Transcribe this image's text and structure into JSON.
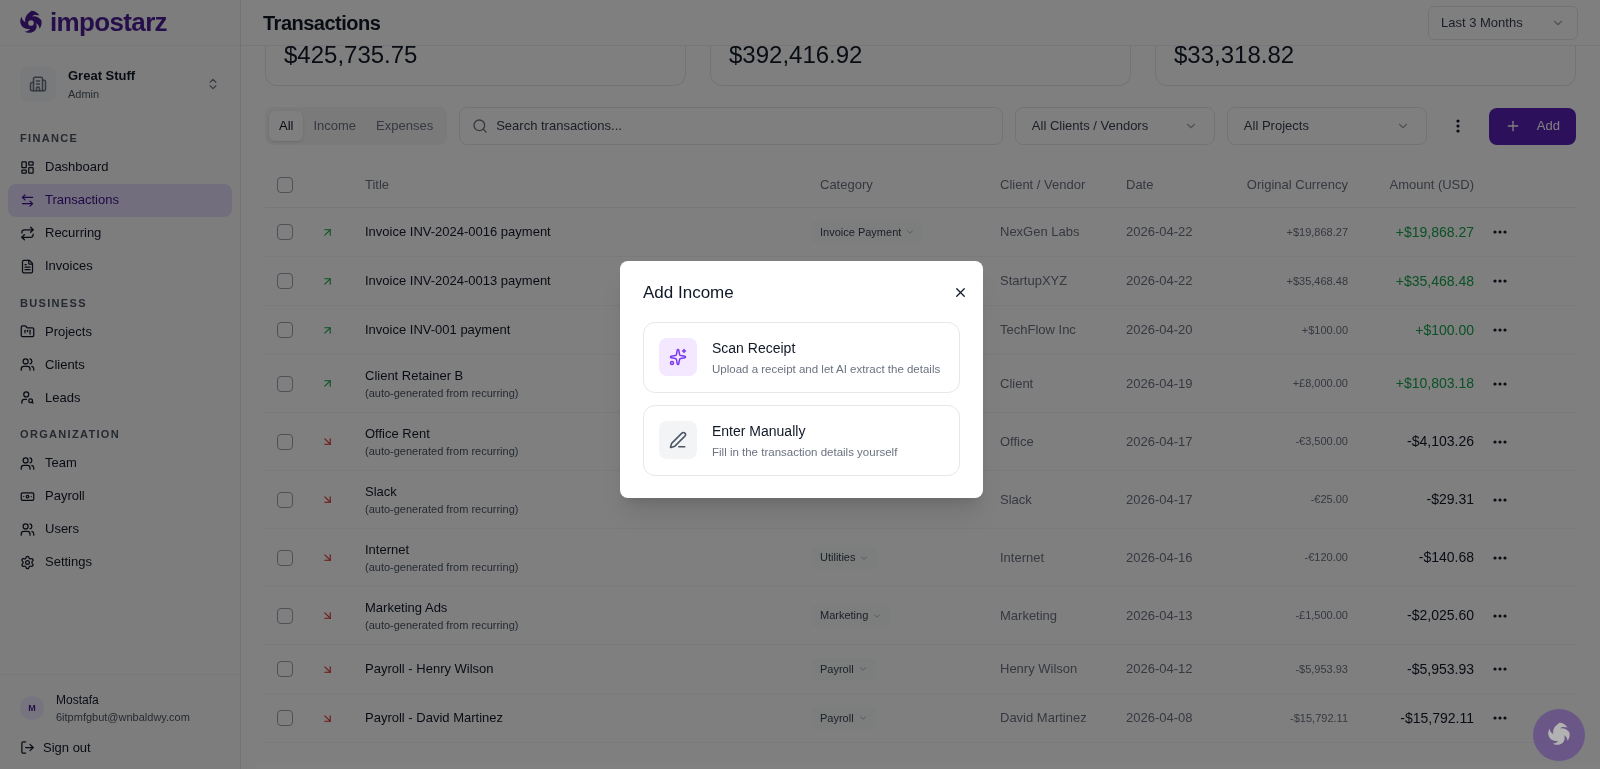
{
  "brand": {
    "name": "impostarz"
  },
  "workspace": {
    "name": "Great Stuff",
    "role": "Admin"
  },
  "sidebar": {
    "sections": [
      {
        "title": "FINANCE",
        "items": [
          {
            "label": "Dashboard",
            "selected": false
          },
          {
            "label": "Transactions",
            "selected": true
          },
          {
            "label": "Recurring",
            "selected": false
          },
          {
            "label": "Invoices",
            "selected": false
          }
        ]
      },
      {
        "title": "BUSINESS",
        "items": [
          {
            "label": "Projects",
            "selected": false
          },
          {
            "label": "Clients",
            "selected": false
          },
          {
            "label": "Leads",
            "selected": false
          }
        ]
      },
      {
        "title": "ORGANIZATION",
        "items": [
          {
            "label": "Team",
            "selected": false
          },
          {
            "label": "Payroll",
            "selected": false
          },
          {
            "label": "Users",
            "selected": false
          },
          {
            "label": "Settings",
            "selected": false
          }
        ]
      }
    ]
  },
  "user": {
    "initial": "M",
    "name": "Mostafa",
    "email": "6itpmfgbut@wnbaldwy.com",
    "sign_out": "Sign out"
  },
  "header": {
    "title": "Transactions",
    "period": "Last 3 Months"
  },
  "stats": [
    "$425,735.75",
    "$392,416.92",
    "$33,318.82"
  ],
  "tabs": [
    {
      "label": "All",
      "selected": true
    },
    {
      "label": "Income",
      "selected": false
    },
    {
      "label": "Expenses",
      "selected": false
    }
  ],
  "search": {
    "placeholder": "Search transactions..."
  },
  "filters": [
    "All Clients / Vendors",
    "All Projects"
  ],
  "add_button": "Add",
  "table": {
    "all_checked": false,
    "columns": [
      "Title",
      "Category",
      "Client / Vendor",
      "Date",
      "Original Currency",
      "Amount (USD)"
    ],
    "rows": [
      {
        "kind": "income",
        "checked": false,
        "title": "Invoice INV-2024-0016 payment",
        "category": "Invoice Payment",
        "client": "NexGen Labs",
        "date": "2026-04-22",
        "original": "+$19,868.27",
        "amount": "+$19,868.27"
      },
      {
        "kind": "income",
        "checked": false,
        "title": "Invoice INV-2024-0013 payment",
        "client": "StartupXYZ",
        "date": "2026-04-22",
        "original": "+$35,468.48",
        "amount": "+$35,468.48"
      },
      {
        "kind": "income",
        "checked": false,
        "title": "Invoice INV-001 payment",
        "client": "TechFlow Inc",
        "date": "2026-04-20",
        "original": "+$100.00",
        "amount": "+$100.00"
      },
      {
        "kind": "income",
        "checked": false,
        "title": "Client Retainer B",
        "note": "(auto-generated from recurring)",
        "client": "Client",
        "date": "2026-04-19",
        "original": "+£8,000.00",
        "amount": "+$10,803.18"
      },
      {
        "kind": "expense",
        "checked": false,
        "title": "Office Rent",
        "note": "(auto-generated from recurring)",
        "client": "Office",
        "date": "2026-04-17",
        "original": "-€3,500.00",
        "amount": "-$4,103.26"
      },
      {
        "kind": "expense",
        "checked": false,
        "title": "Slack",
        "note": "(auto-generated from recurring)",
        "client": "Slack",
        "date": "2026-04-17",
        "original": "-€25.00",
        "amount": "-$29.31"
      },
      {
        "kind": "expense",
        "checked": false,
        "title": "Internet",
        "note": "(auto-generated from recurring)",
        "category": "Utilities",
        "client": "Internet",
        "date": "2026-04-16",
        "original": "-€120.00",
        "amount": "-$140.68"
      },
      {
        "kind": "expense",
        "checked": false,
        "title": "Marketing Ads",
        "note": "(auto-generated from recurring)",
        "category": "Marketing",
        "client": "Marketing",
        "date": "2026-04-13",
        "original": "-£1,500.00",
        "amount": "-$2,025.60"
      },
      {
        "kind": "expense",
        "checked": false,
        "title": "Payroll - Henry Wilson",
        "category": "Payroll",
        "client": "Henry Wilson",
        "date": "2026-04-12",
        "original": "-$5,953.93",
        "amount": "-$5,953.93"
      },
      {
        "kind": "expense",
        "checked": false,
        "title": "Payroll - David Martinez",
        "category": "Payroll",
        "client": "David Martinez",
        "date": "2026-04-08",
        "original": "-$15,792.11",
        "amount": "-$15,792.11"
      }
    ]
  },
  "dialog": {
    "title": "Add Income",
    "options": [
      {
        "kind": "scan",
        "title": "Scan Receipt",
        "description": "Upload a receipt and let AI extract the details"
      },
      {
        "kind": "manual",
        "title": "Enter Manually",
        "description": "Fill in the transaction details yourself"
      }
    ]
  }
}
